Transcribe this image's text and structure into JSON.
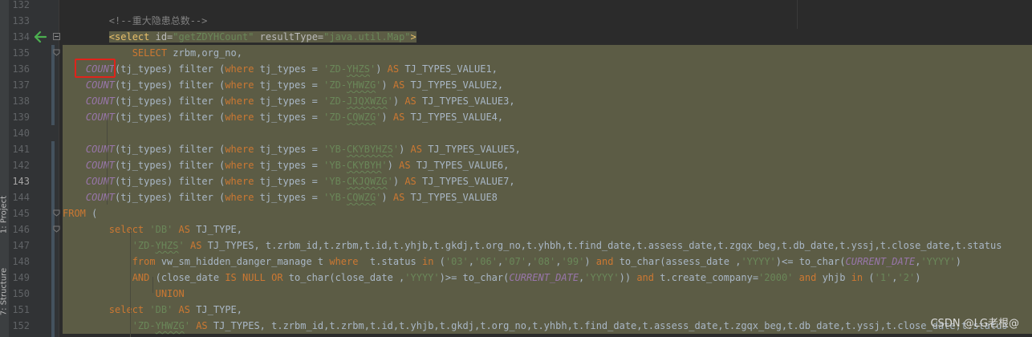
{
  "tool_windows": {
    "project_label": "1: Project",
    "structure_label": "7: Structure"
  },
  "lines": [
    {
      "n": "132",
      "html": ""
    },
    {
      "n": "133",
      "html": "        <span class=\"cm\">&lt;!--重大隐患总数--&gt;</span>"
    },
    {
      "n": "134",
      "html": "        <span class=\"tg\">&lt;select </span><span class=\"at\">id=</span><span class=\"av\">\"getZDYHCount\"</span> <span class=\"at\">resultType=</span><span class=\"av\">\"java.util.Map\"</span><span class=\"tg\">&gt;</span>"
    },
    {
      "n": "135",
      "html": "            <span class=\"kw\">SELECT</span> zrbm,org_no,"
    },
    {
      "n": "136",
      "html": "    <span class=\"fn\">COUNT</span>(tj_types) filter (<span class=\"kw\">where</span> tj_types = <span class=\"st\">'ZD-<span class=\"uw\">YHZS</span>'</span>) <span class=\"kw\">AS</span> TJ_TYPES_VALUE1,"
    },
    {
      "n": "137",
      "html": "    <span class=\"fn\">COUNT</span>(tj_types) filter (<span class=\"kw\">where</span> tj_types = <span class=\"st\">'ZD-<span class=\"uw\">YHWZG</span>'</span>) <span class=\"kw\">AS</span> TJ_TYPES_VALUE2,"
    },
    {
      "n": "138",
      "html": "    <span class=\"fn\">COUNT</span>(tj_types) filter (<span class=\"kw\">where</span> tj_types = <span class=\"st\">'ZD-<span class=\"uw\">JJQXWZG</span>'</span>) <span class=\"kw\">AS</span> TJ_TYPES_VALUE3,"
    },
    {
      "n": "139",
      "html": "    <span class=\"fn\">COUNT</span>(tj_types) filter (<span class=\"kw\">where</span> tj_types = <span class=\"st\">'ZD-<span class=\"uw\">CQWZG</span>'</span>) <span class=\"kw\">AS</span> TJ_TYPES_VALUE4,"
    },
    {
      "n": "140",
      "html": ""
    },
    {
      "n": "141",
      "html": "    <span class=\"fn\">COUNT</span>(tj_types) filter (<span class=\"kw\">where</span> tj_types = <span class=\"st\">'YB-<span class=\"uw\">CKYBYHZS</span>'</span>) <span class=\"kw\">AS</span> TJ_TYPES_VALUE5,"
    },
    {
      "n": "142",
      "html": "    <span class=\"fn\">COUNT</span>(tj_types) filter (<span class=\"kw\">where</span> tj_types = <span class=\"st\">'YB-<span class=\"uw\">CKYBYH</span>'</span>) <span class=\"kw\">AS</span> TJ_TYPES_VALUE6,"
    },
    {
      "n": "143",
      "html": "    <span class=\"fn\">COUNT</span>(tj_types) filter (<span class=\"kw\">where</span> tj_types = <span class=\"st\">'YB-<span class=\"uw\">CKJQWZG</span>'</span>) <span class=\"kw\">AS</span> TJ_TYPES_VALUE7,"
    },
    {
      "n": "144",
      "html": "    <span class=\"fn\">COUNT</span>(tj_types) filter (<span class=\"kw\">where</span> tj_types = <span class=\"st\">'YB-<span class=\"uw\">CQWZG</span>'</span>) <span class=\"kw\">AS</span> TJ_TYPES_VALUE8"
    },
    {
      "n": "145",
      "html": "<span class=\"kw\">FROM</span> ("
    },
    {
      "n": "146",
      "html": "        <span class=\"kw\">select</span> <span class=\"st\">'DB'</span> <span class=\"kw\">AS</span> TJ_TYPE,"
    },
    {
      "n": "147",
      "html": "            <span class=\"st\">'ZD-<span class=\"uw\">YHZS</span>'</span> <span class=\"kw\">AS</span> TJ_TYPES, t.zrbm_id,t.zrbm,t.id,t.yhjb,t.gkdj,t.org_no,t.yhbh,t.find_date,t.assess_date,t.zgqx_beg,t.db_date,t.yssj,t.close_date,t.status"
    },
    {
      "n": "148",
      "html": "            <span class=\"kw\">from</span> vw_sm_hidden_danger_manage t <span class=\"kw\">where</span>  t.status <span class=\"kw\">in</span> (<span class=\"st\">'03'</span>,<span class=\"st\">'06'</span>,<span class=\"st\">'07'</span>,<span class=\"st\">'08'</span>,<span class=\"st\">'99'</span>) <span class=\"kw\">and</span> to_char(assess_date ,<span class=\"st\">'YYYY'</span>)&lt;= to_char(<span class=\"fn\">CURRENT_DATE</span>,<span class=\"st\">'YYYY'</span>)"
    },
    {
      "n": "149",
      "html": "            <span class=\"kw\">AND</span> (close_date <span class=\"kw\">IS NULL OR</span> to_char(close_date ,<span class=\"st\">'YYYY'</span>)&gt;= to_char(<span class=\"fn\">CURRENT_DATE</span>,<span class=\"st\">'YYYY'</span>)) <span class=\"kw\">and</span> t.create_company=<span class=\"st\">'2000'</span> <span class=\"kw\">and</span> yhjb <span class=\"kw\">in</span> (<span class=\"st\">'1'</span>,<span class=\"st\">'2'</span>)"
    },
    {
      "n": "150",
      "html": "                <span class=\"kw\">UNION</span>"
    },
    {
      "n": "151",
      "html": "        <span class=\"kw\">select</span> <span class=\"st\">'DB'</span> <span class=\"kw\">AS</span> TJ_TYPE,"
    },
    {
      "n": "152",
      "html": "            <span class=\"st\">'ZD-<span class=\"uw\">YHWZG</span>'</span> <span class=\"kw\">AS</span> TJ_TYPES, t.zrbm_id,t.zrbm,t.id,t.yhjb,t.gkdj,t.org_no,t.yhbh,t.find_date,t.assess_date,t.zgqx_beg,t.db_date,t.yssj,t.close_date,t.status"
    }
  ],
  "watermark": "CSDN @LG老根@",
  "colors": {
    "editor_bg": "#2b2b2b",
    "selection_bg": "#5c5c45",
    "keyword": "#cc7832",
    "string": "#6a8759",
    "function_italic": "#9876aa",
    "tag": "#e8bf6a",
    "highlight_box": "#e0231b"
  },
  "icons": {
    "navigate_back": "green-left-arrow-icon",
    "intention_bulb": "lightbulb-icon"
  }
}
